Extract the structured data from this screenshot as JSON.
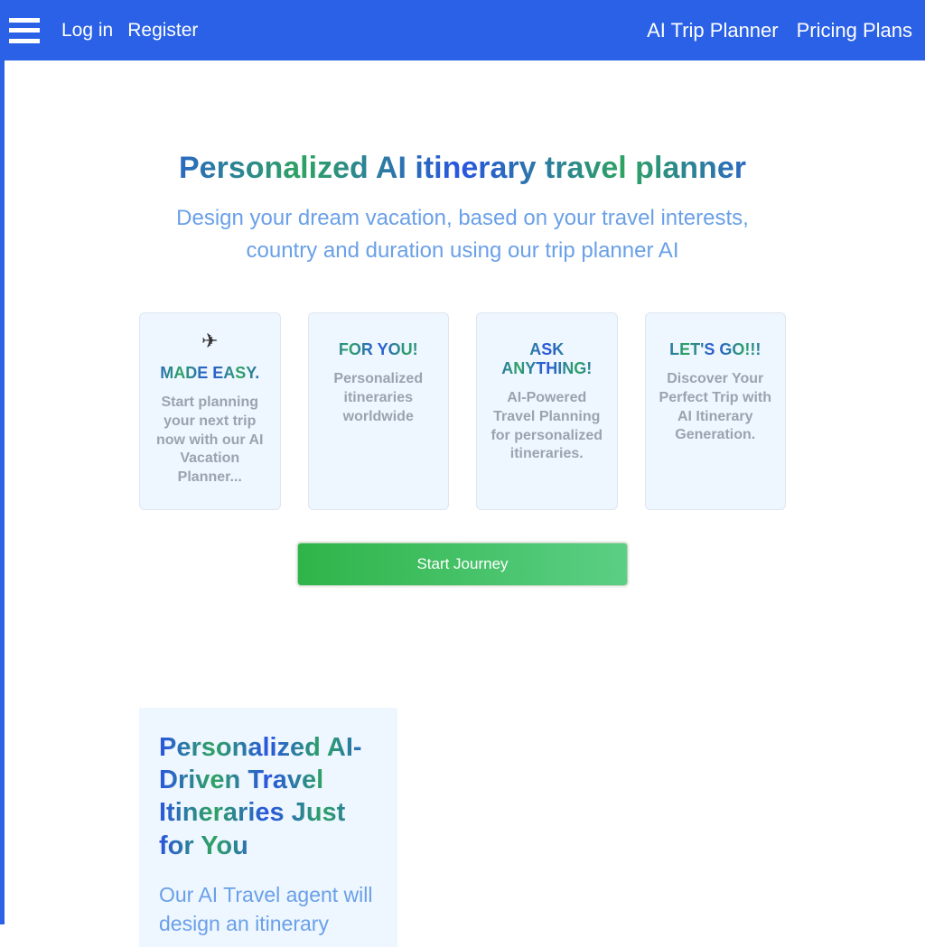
{
  "header": {
    "login": "Log in",
    "register": "Register",
    "nav1": "AI Trip Planner",
    "nav2": "Pricing Plans"
  },
  "hero": {
    "title": "Personalized AI itinerary travel planner",
    "subtitle": "Design your dream vacation, based on your travel interests, country and duration using our trip planner AI"
  },
  "cards": [
    {
      "icon": "✈",
      "title": "MADE EASY.",
      "desc": "Start planning your next trip now with our AI Vacation Planner..."
    },
    {
      "icon": "",
      "title": "FOR YOU!",
      "desc": "Personalized itineraries worldwide"
    },
    {
      "icon": "",
      "title": "ASK ANYTHING!",
      "desc": "AI-Powered Travel Planning for personalized itineraries."
    },
    {
      "icon": "",
      "title": "LET'S GO!!!",
      "desc": "Discover Your Perfect Trip with AI Itinerary Generation."
    }
  ],
  "cta": {
    "label": "Start Journey"
  },
  "section2": {
    "title": "Personalized AI-Driven Travel Itineraries Just for You",
    "subtitle": "Our AI Travel agent will design an itinerary"
  }
}
